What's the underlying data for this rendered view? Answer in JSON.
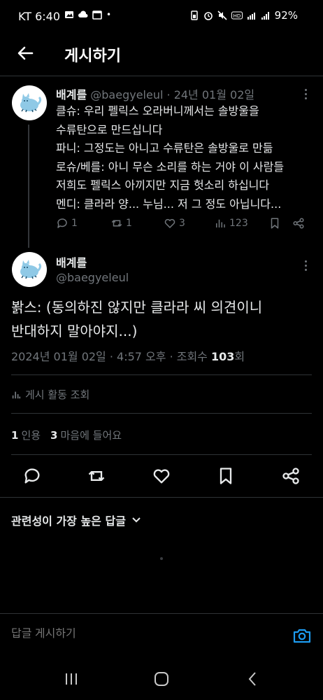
{
  "status_bar": {
    "carrier_time": "KT 6:40",
    "battery": "92%"
  },
  "header": {
    "title": "게시하기"
  },
  "parent_tweet": {
    "name": "배계를",
    "handle": "@baegyeleul",
    "date": "· 24년 01월 02일",
    "lines": [
      "클슈: 우리 펠릭스 오라버니께서는 솔방울을",
      "수류탄으로 만드십니다",
      "파니: 그정도는 아니고 수류탄은 솔방울로 만듦",
      "로슈/베를: 아니 무슨 소리를 하는 거야 이 사람들",
      "저희도 펠릭스 아끼지만 지금 헛소리 하십니다",
      "멘디: 클라라 양... 누님... 저 그 정도 아닙니다..."
    ],
    "replies": "1",
    "retweets": "1",
    "likes": "3",
    "views": "123"
  },
  "main_tweet": {
    "name": "배계를",
    "handle": "@baegyeleul",
    "body_line1": "봙스: (동의하진 않지만 클라라 씨 의견이니",
    "body_line2": "반대하지 말아야지...)",
    "meta_prefix": "2024년 01월 02일 · 4:57 오후 · 조회수 ",
    "views": "103",
    "meta_suffix": "회"
  },
  "activity_label": "게시 활동 조회",
  "stats": {
    "quotes": "1",
    "quotes_label": "인용",
    "likes": "3",
    "likes_label": "마음에 들어요"
  },
  "sort_label": "관련성이 가장 높은 답글",
  "reply": {
    "placeholder": "답글 게시하기"
  },
  "colors": {
    "background": "#000000",
    "text": "#e7e9ea",
    "muted": "#71767b",
    "accent": "#1d9bf0",
    "divider": "#2f3336"
  }
}
